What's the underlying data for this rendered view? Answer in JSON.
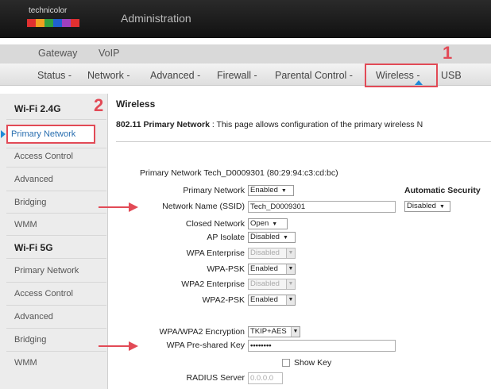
{
  "header": {
    "brand": "technicolor",
    "title": "Administration",
    "brand_colors": [
      "#e03030",
      "#f0a020",
      "#30a040",
      "#2060d0",
      "#a040c0",
      "#e03030"
    ]
  },
  "top_tabs": [
    "Gateway",
    "VoIP"
  ],
  "nav": {
    "items": [
      "Status -",
      "Network -",
      "Advanced -",
      "Firewall -",
      "Parental Control -",
      "Wireless -",
      "USB"
    ],
    "active": "Wireless -"
  },
  "callouts": [
    "1",
    "2"
  ],
  "sidebar": {
    "section1_title": "Wi-Fi 2.4G",
    "section1_items": [
      "Primary Network",
      "Access Control",
      "Advanced",
      "Bridging",
      "WMM"
    ],
    "section2_title": "Wi-Fi 5G",
    "section2_items": [
      "Primary Network",
      "Access Control",
      "Advanced",
      "Bridging",
      "WMM"
    ]
  },
  "main": {
    "title": "Wireless",
    "desc_bold": "802.11 Primary Network",
    "desc_rest": " :  This page allows configuration of the primary wireless N",
    "network_header": "Primary Network Tech_D0009301 (80:29:94:c3:cd:bc)",
    "auto_security_label": "Automatic Security",
    "auto_security_value": "Disabled",
    "fields": {
      "primary_network": {
        "label": "Primary Network",
        "value": "Enabled"
      },
      "ssid": {
        "label": "Network Name (SSID)",
        "value": "Tech_D0009301"
      },
      "closed_network": {
        "label": "Closed Network",
        "value": "Open"
      },
      "ap_isolate": {
        "label": "AP Isolate",
        "value": "Disabled"
      },
      "wpa_enterprise": {
        "label": "WPA Enterprise",
        "value": "Disabled"
      },
      "wpa_psk": {
        "label": "WPA-PSK",
        "value": "Enabled"
      },
      "wpa2_enterprise": {
        "label": "WPA2 Enterprise",
        "value": "Disabled"
      },
      "wpa2_psk": {
        "label": "WPA2-PSK",
        "value": "Enabled"
      },
      "encryption": {
        "label": "WPA/WPA2 Encryption",
        "value": "TKIP+AES"
      },
      "psk": {
        "label": "WPA Pre-shared Key",
        "value": "••••••••"
      },
      "show_key": {
        "label": "Show Key"
      },
      "radius": {
        "label": "RADIUS Server",
        "value": "0.0.0.0"
      }
    }
  },
  "colors": {
    "accent_red": "#e24a56",
    "accent_blue": "#1e8ad8"
  }
}
